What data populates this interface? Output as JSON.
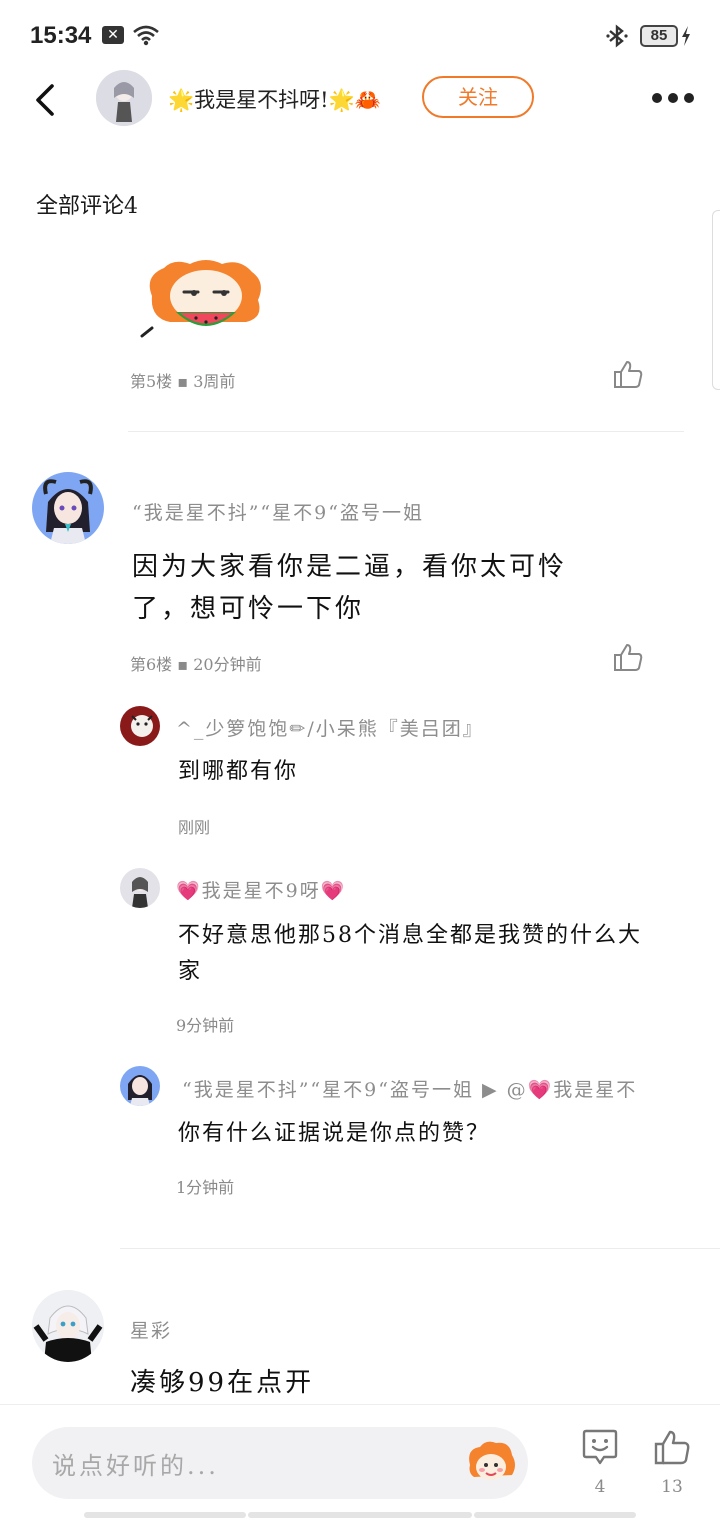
{
  "status_bar": {
    "time": "15:34",
    "x_badge": "✕",
    "battery": "85"
  },
  "header": {
    "name": "🌟我是星不抖呀!🌟🦀",
    "follow_label": "关注"
  },
  "section_title": "全部评论4",
  "comments": [
    {
      "floor": "第5楼",
      "time": "3周前"
    },
    {
      "username": "“我是星不抖”“星不9“盗号一姐",
      "content_line1": "因为大家看你是二逼，看你太可怜",
      "content_line2": "了，想可怜一下你",
      "floor": "第6楼",
      "time": "20分钟前",
      "replies": [
        {
          "username": "^_少箩饱饱✏/小呆熊『美吕团』",
          "content": "到哪都有你",
          "time": "刚刚"
        },
        {
          "username": "💗我是星不9呀💗",
          "content_line1": "不好意思他那58个消息全都是我赞的什么大",
          "content_line2": "家",
          "time": "9分钟前"
        },
        {
          "username": "“我是星不抖”“星不9“盗号一姐 ▶ @💗我是星不",
          "content": "你有什么证据说是你点的赞？",
          "time": "1分钟前"
        }
      ]
    },
    {
      "username": "星彩",
      "content": "凑够99在点开"
    }
  ],
  "input_bar": {
    "placeholder": "说点好听的...",
    "comment_count": "4",
    "like_count": "13"
  },
  "colors": {
    "accent": "#f07a2a",
    "meta": "#8a8a8a"
  }
}
